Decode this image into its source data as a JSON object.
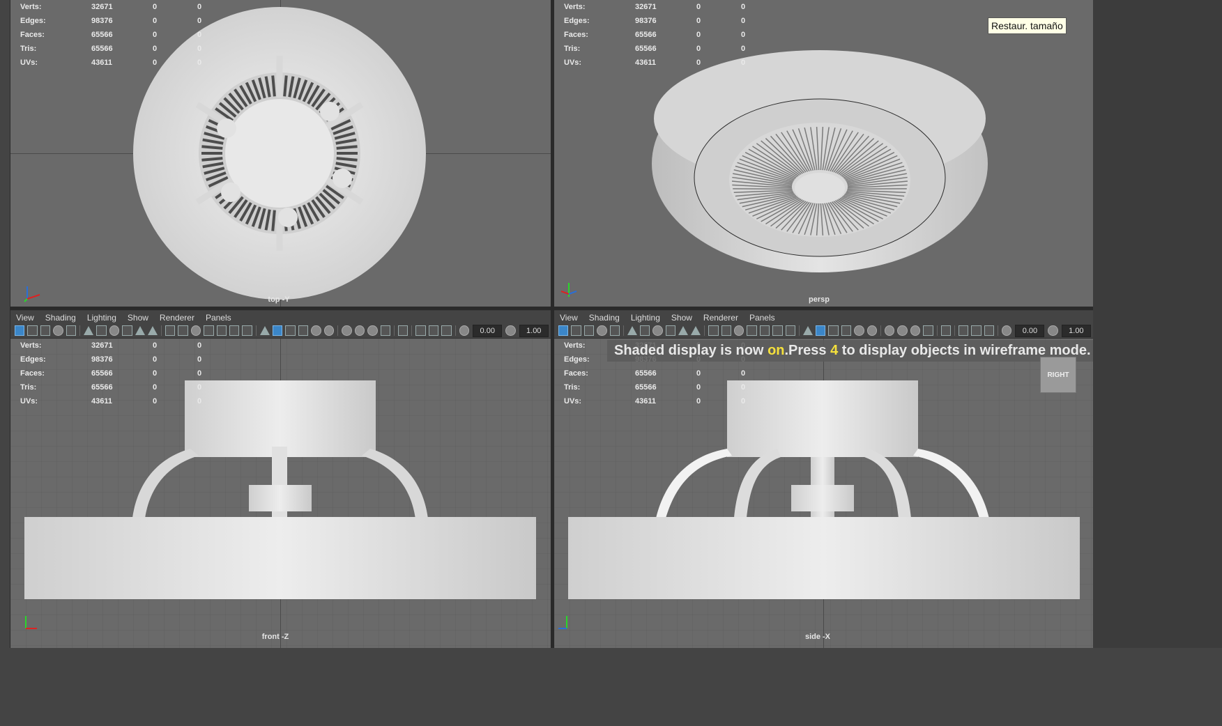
{
  "stats": {
    "labels": [
      "Verts:",
      "Edges:",
      "Faces:",
      "Tris:",
      "UVs:"
    ],
    "values": [
      "32671",
      "98376",
      "65566",
      "65566",
      "43611"
    ],
    "zero_a": "0",
    "zero_b": "0"
  },
  "panels": {
    "top": {
      "camera": "top -Y"
    },
    "persp": {
      "camera": "persp"
    },
    "front": {
      "camera": "front -Z"
    },
    "side": {
      "camera": "side -X"
    }
  },
  "menu": [
    "View",
    "Shading",
    "Lighting",
    "Show",
    "Renderer",
    "Panels"
  ],
  "toolbar": {
    "exposure": "0.00",
    "gamma": "1.00"
  },
  "tooltip": "Restaur. tamaño",
  "message": {
    "part1": "Shaded display is now ",
    "on": "on",
    "part2": ".Press ",
    "key": "4",
    "part3": " to display objects in wireframe mode."
  },
  "viewcube": "RIGHT",
  "icons": {
    "axis": "axis-gizmo-icon",
    "tools": [
      "select-camera-icon",
      "lock-camera-icon",
      "bookmark-icon",
      "image-plane-icon",
      "grid-icon",
      "film-gate-icon",
      "resolution-gate-icon",
      "gate-mask-icon",
      "field-chart-icon",
      "safe-action-icon",
      "safe-title-icon",
      "wireframe-icon",
      "smooth-shade-icon",
      "wireframe-on-shaded-icon",
      "textured-icon",
      "use-lights-icon",
      "shadows-icon",
      "ambient-occlusion-icon",
      "motion-blur-icon",
      "anti-aliasing-icon",
      "depth-of-field-icon",
      "isolate-select-icon",
      "xray-icon",
      "xray-joints-icon",
      "backface-culling-icon",
      "exposure-icon",
      "gamma-icon"
    ]
  },
  "colors": {
    "viewport_bg": "#6a6a6a",
    "accent": "#3b86c8",
    "highlight": "#f4e03c"
  }
}
